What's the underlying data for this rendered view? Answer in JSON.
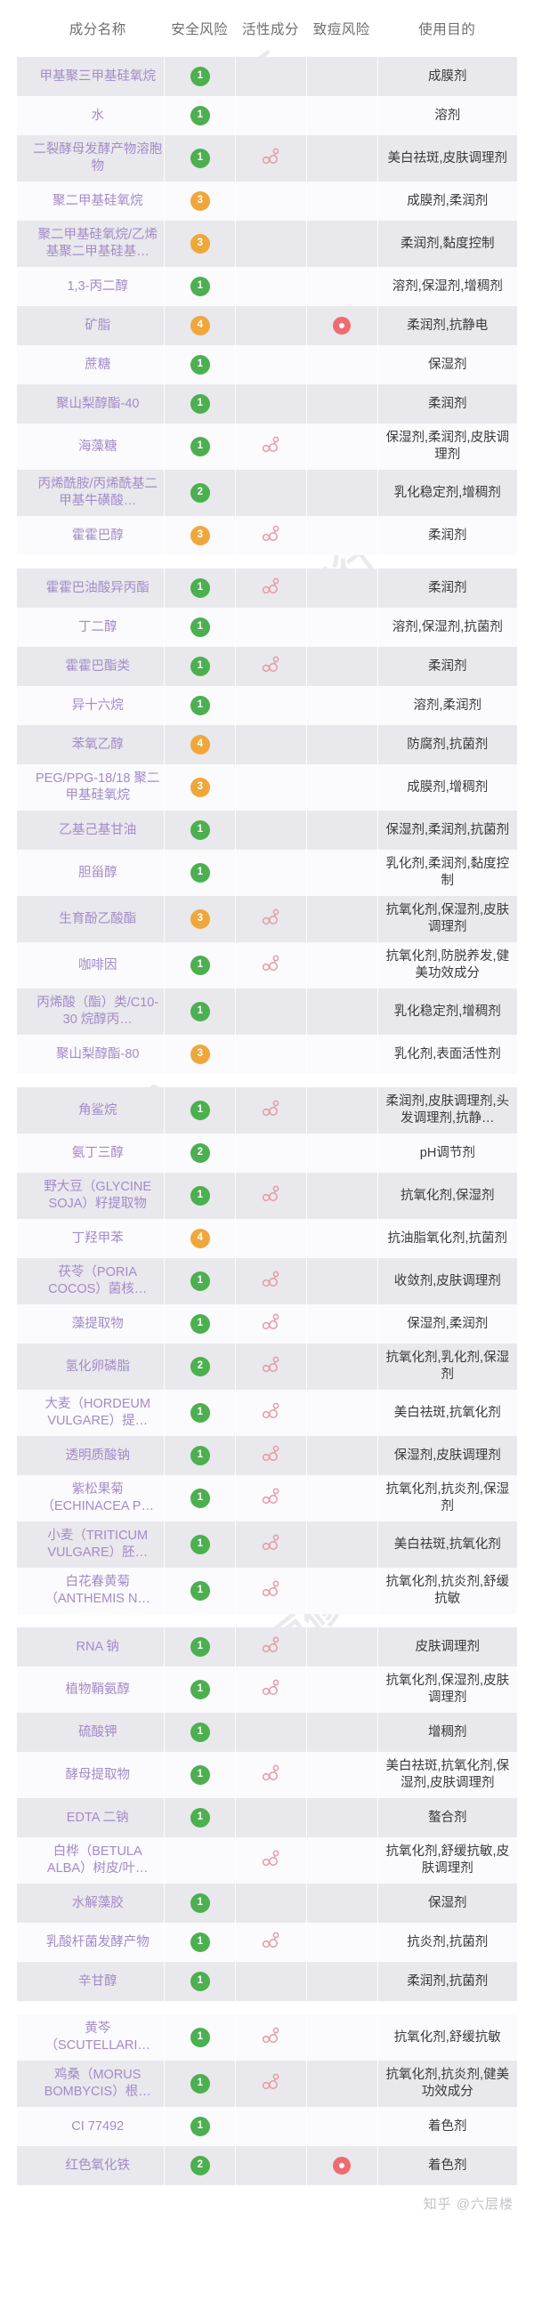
{
  "header": {
    "columns": [
      "成分名称",
      "安全风险",
      "活性成分",
      "致痘风险",
      "使用目的"
    ]
  },
  "icons": {
    "active": "molecule-icon",
    "acne": "acne-risk-dot-icon"
  },
  "colors": {
    "safe_green": "#4caf50",
    "safe_orange": "#efa73c",
    "acne_red": "#ef6b72",
    "ingredient_text": "#a38bc9",
    "purpose_text": "#3a3a3e",
    "row_light": "#fbfafc",
    "row_dark": "#e9e8ec",
    "header_text": "#6e6e73"
  },
  "watermarks": [
    "美丽修行",
    "m",
    "美丽修行",
    "m",
    "美丽修行",
    "m",
    "美丽修行",
    "m"
  ],
  "footer": {
    "credit": "知乎 @六层楼"
  },
  "groups": [
    {
      "rows": [
        {
          "name": "甲基聚三甲基硅氧烷",
          "safety": "1",
          "safety_level": "green",
          "active": false,
          "acne": false,
          "purpose": "成膜剂"
        },
        {
          "name": "水",
          "safety": "1",
          "safety_level": "green",
          "active": false,
          "acne": false,
          "purpose": "溶剂"
        },
        {
          "name": "二裂酵母发酵产物溶胞物",
          "safety": "1",
          "safety_level": "green",
          "active": true,
          "acne": false,
          "purpose": "美白祛斑,皮肤调理剂"
        },
        {
          "name": "聚二甲基硅氧烷",
          "safety": "3",
          "safety_level": "orange",
          "active": false,
          "acne": false,
          "purpose": "成膜剂,柔润剂"
        },
        {
          "name": "聚二甲基硅氧烷/乙烯基聚二甲基硅基…",
          "safety": "3",
          "safety_level": "orange",
          "active": false,
          "acne": false,
          "purpose": "柔润剂,黏度控制"
        },
        {
          "name": "1,3-丙二醇",
          "safety": "1",
          "safety_level": "green",
          "active": false,
          "acne": false,
          "purpose": "溶剂,保湿剂,增稠剂"
        },
        {
          "name": "矿脂",
          "safety": "4",
          "safety_level": "orange",
          "active": false,
          "acne": true,
          "purpose": "柔润剂,抗静电"
        },
        {
          "name": "蔗糖",
          "safety": "1",
          "safety_level": "green",
          "active": false,
          "acne": false,
          "purpose": "保湿剂"
        },
        {
          "name": "聚山梨醇酯-40",
          "safety": "1",
          "safety_level": "green",
          "active": false,
          "acne": false,
          "purpose": "柔润剂"
        },
        {
          "name": "海藻糖",
          "safety": "1",
          "safety_level": "green",
          "active": true,
          "acne": false,
          "purpose": "保湿剂,柔润剂,皮肤调理剂"
        },
        {
          "name": "丙烯酰胺/丙烯酰基二甲基牛磺酸…",
          "safety": "2",
          "safety_level": "green",
          "active": false,
          "acne": false,
          "purpose": "乳化稳定剂,增稠剂"
        },
        {
          "name": "霍霍巴醇",
          "safety": "3",
          "safety_level": "orange",
          "active": true,
          "acne": false,
          "purpose": "柔润剂"
        }
      ]
    },
    {
      "rows": [
        {
          "name": "霍霍巴油酸异丙酯",
          "safety": "1",
          "safety_level": "green",
          "active": true,
          "acne": false,
          "purpose": "柔润剂"
        },
        {
          "name": "丁二醇",
          "safety": "1",
          "safety_level": "green",
          "active": false,
          "acne": false,
          "purpose": "溶剂,保湿剂,抗菌剂"
        },
        {
          "name": "霍霍巴酯类",
          "safety": "1",
          "safety_level": "green",
          "active": true,
          "acne": false,
          "purpose": "柔润剂"
        },
        {
          "name": "异十六烷",
          "safety": "1",
          "safety_level": "green",
          "active": false,
          "acne": false,
          "purpose": "溶剂,柔润剂"
        },
        {
          "name": "苯氧乙醇",
          "safety": "4",
          "safety_level": "orange",
          "active": false,
          "acne": false,
          "purpose": "防腐剂,抗菌剂"
        },
        {
          "name": "PEG/PPG-18/18 聚二甲基硅氧烷",
          "safety": "3",
          "safety_level": "orange",
          "active": false,
          "acne": false,
          "purpose": "成膜剂,增稠剂"
        },
        {
          "name": "乙基己基甘油",
          "safety": "1",
          "safety_level": "green",
          "active": false,
          "acne": false,
          "purpose": "保湿剂,柔润剂,抗菌剂"
        },
        {
          "name": "胆甾醇",
          "safety": "1",
          "safety_level": "green",
          "active": false,
          "acne": false,
          "purpose": "乳化剂,柔润剂,黏度控制"
        },
        {
          "name": "生育酚乙酸酯",
          "safety": "3",
          "safety_level": "orange",
          "active": true,
          "acne": false,
          "purpose": "抗氧化剂,保湿剂,皮肤调理剂"
        },
        {
          "name": "咖啡因",
          "safety": "1",
          "safety_level": "green",
          "active": true,
          "acne": false,
          "purpose": "抗氧化剂,防脱养发,健美功效成分"
        },
        {
          "name": "丙烯酸（酯）类/C10-30 烷醇丙…",
          "safety": "1",
          "safety_level": "green",
          "active": false,
          "acne": false,
          "purpose": "乳化稳定剂,增稠剂"
        },
        {
          "name": "聚山梨醇酯-80",
          "safety": "3",
          "safety_level": "orange",
          "active": false,
          "acne": false,
          "purpose": "乳化剂,表面活性剂"
        }
      ]
    },
    {
      "rows": [
        {
          "name": "角鲨烷",
          "safety": "1",
          "safety_level": "green",
          "active": true,
          "acne": false,
          "purpose": "柔润剂,皮肤调理剂,头发调理剂,抗静…"
        },
        {
          "name": "氨丁三醇",
          "safety": "2",
          "safety_level": "green",
          "active": false,
          "acne": false,
          "purpose": "pH调节剂"
        },
        {
          "name": "野大豆（GLYCINE SOJA）籽提取物",
          "safety": "1",
          "safety_level": "green",
          "active": true,
          "acne": false,
          "purpose": "抗氧化剂,保湿剂"
        },
        {
          "name": "丁羟甲苯",
          "safety": "4",
          "safety_level": "orange",
          "active": false,
          "acne": false,
          "purpose": "抗油脂氧化剂,抗菌剂"
        },
        {
          "name": "茯苓（PORIA COCOS）菌核…",
          "safety": "1",
          "safety_level": "green",
          "active": true,
          "acne": false,
          "purpose": "收敛剂,皮肤调理剂"
        },
        {
          "name": "藻提取物",
          "safety": "1",
          "safety_level": "green",
          "active": true,
          "acne": false,
          "purpose": "保湿剂,柔润剂"
        },
        {
          "name": "氢化卵磷脂",
          "safety": "2",
          "safety_level": "green",
          "active": true,
          "acne": false,
          "purpose": "抗氧化剂,乳化剂,保湿剂"
        },
        {
          "name": "大麦（HORDEUM VULGARE）提…",
          "safety": "1",
          "safety_level": "green",
          "active": true,
          "acne": false,
          "purpose": "美白祛斑,抗氧化剂"
        },
        {
          "name": "透明质酸钠",
          "safety": "1",
          "safety_level": "green",
          "active": true,
          "acne": false,
          "purpose": "保湿剂,皮肤调理剂"
        },
        {
          "name": "紫松果菊（ECHINACEA P…",
          "safety": "1",
          "safety_level": "green",
          "active": true,
          "acne": false,
          "purpose": "抗氧化剂,抗炎剂,保湿剂"
        },
        {
          "name": "小麦（TRITICUM VULGARE）胚…",
          "safety": "1",
          "safety_level": "green",
          "active": true,
          "acne": false,
          "purpose": "美白祛斑,抗氧化剂"
        },
        {
          "name": "白花春黄菊（ANTHEMIS N…",
          "safety": "1",
          "safety_level": "green",
          "active": true,
          "acne": false,
          "purpose": "抗氧化剂,抗炎剂,舒缓抗敏"
        }
      ]
    },
    {
      "rows": [
        {
          "name": "RNA 钠",
          "safety": "1",
          "safety_level": "green",
          "active": true,
          "acne": false,
          "purpose": "皮肤调理剂"
        },
        {
          "name": "植物鞘氨醇",
          "safety": "1",
          "safety_level": "green",
          "active": true,
          "acne": false,
          "purpose": "抗氧化剂,保湿剂,皮肤调理剂"
        },
        {
          "name": "硫酸钾",
          "safety": "1",
          "safety_level": "green",
          "active": false,
          "acne": false,
          "purpose": "增稠剂"
        },
        {
          "name": "酵母提取物",
          "safety": "1",
          "safety_level": "green",
          "active": true,
          "acne": false,
          "purpose": "美白祛斑,抗氧化剂,保湿剂,皮肤调理剂"
        },
        {
          "name": "EDTA 二钠",
          "safety": "1",
          "safety_level": "green",
          "active": false,
          "acne": false,
          "purpose": "螯合剂"
        },
        {
          "name": "白桦（BETULA ALBA）树皮/叶…",
          "safety": "",
          "safety_level": "none",
          "active": true,
          "acne": false,
          "purpose": "抗氧化剂,舒缓抗敏,皮肤调理剂"
        },
        {
          "name": "水解藻胶",
          "safety": "1",
          "safety_level": "green",
          "active": false,
          "acne": false,
          "purpose": "保湿剂"
        },
        {
          "name": "乳酸杆菌发酵产物",
          "safety": "1",
          "safety_level": "green",
          "active": true,
          "acne": false,
          "purpose": "抗炎剂,抗菌剂"
        },
        {
          "name": "辛甘醇",
          "safety": "1",
          "safety_level": "green",
          "active": false,
          "acne": false,
          "purpose": "柔润剂,抗菌剂"
        }
      ]
    },
    {
      "rows": [
        {
          "name": "黄芩（SCUTELLARI…",
          "safety": "1",
          "safety_level": "green",
          "active": true,
          "acne": false,
          "purpose": "抗氧化剂,舒缓抗敏"
        },
        {
          "name": "鸡桑（MORUS BOMBYCIS）根…",
          "safety": "1",
          "safety_level": "green",
          "active": true,
          "acne": false,
          "purpose": "抗氧化剂,抗炎剂,健美功效成分"
        },
        {
          "name": "CI 77492",
          "safety": "1",
          "safety_level": "green",
          "active": false,
          "acne": false,
          "purpose": "着色剂"
        },
        {
          "name": "红色氧化铁",
          "safety": "2",
          "safety_level": "green",
          "active": false,
          "acne": true,
          "purpose": "着色剂"
        }
      ]
    }
  ]
}
